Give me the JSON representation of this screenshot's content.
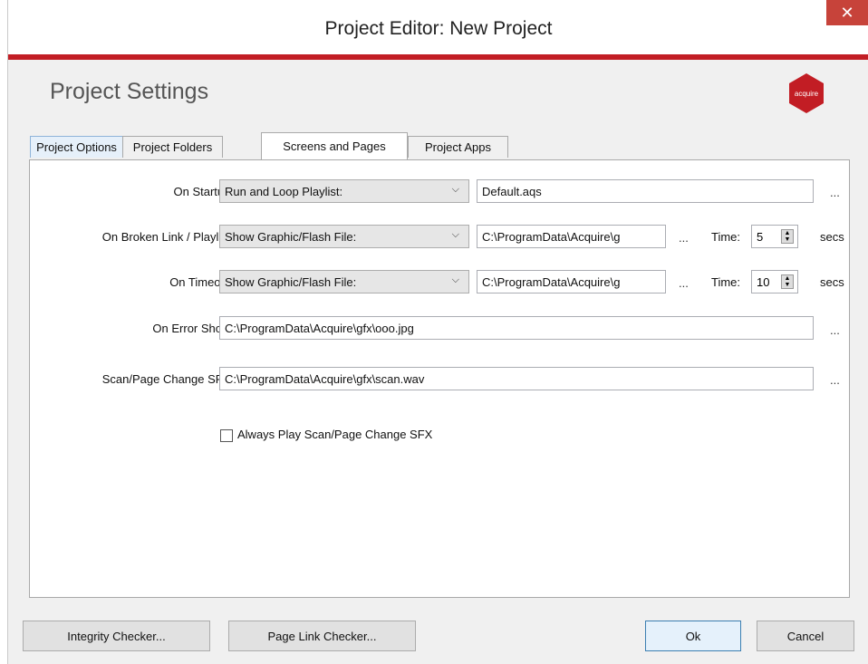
{
  "window": {
    "title": "Project Editor: New Project",
    "close_glyph": "✕"
  },
  "header": {
    "title": "Project Settings",
    "logo_text": "acquire",
    "logo_color": "#c21d24"
  },
  "tabs": [
    {
      "label": "Project Options"
    },
    {
      "label": "Project Folders"
    },
    {
      "label": "Screens and Pages",
      "active": true
    },
    {
      "label": "Project Apps"
    }
  ],
  "form": {
    "startup": {
      "label": "On Startup:",
      "combo_value": "Run and Loop Playlist:",
      "field_value": "Default.aqs",
      "browse": "..."
    },
    "broken_link": {
      "label": "On Broken Link / Playlist:",
      "combo_value": "Show Graphic/Flash File:",
      "field_value": "C:\\ProgramData\\Acquire\\g",
      "browse": "...",
      "time_label": "Time:",
      "time_value": "5",
      "unit": "secs"
    },
    "timeout": {
      "label": "On Timeout:",
      "combo_value": "Show Graphic/Flash File:",
      "field_value": "C:\\ProgramData\\Acquire\\g",
      "browse": "...",
      "time_label": "Time:",
      "time_value": "10",
      "unit": "secs"
    },
    "error_show": {
      "label": "On Error Show:",
      "field_value": "C:\\ProgramData\\Acquire\\gfx\\ooo.jpg",
      "browse": "..."
    },
    "scan_sfx": {
      "label": "Scan/Page Change SFX:",
      "field_value": "C:\\ProgramData\\Acquire\\gfx\\scan.wav",
      "browse": "..."
    },
    "always_play": {
      "label": "Always Play Scan/Page Change SFX",
      "checked": false
    }
  },
  "footer": {
    "integrity": "Integrity Checker...",
    "page_link": "Page Link Checker...",
    "ok": "Ok",
    "cancel": "Cancel"
  },
  "icons": {
    "dropdown": "chevron-down-icon",
    "spin": "spin-updown-icon",
    "close": "close-icon"
  }
}
